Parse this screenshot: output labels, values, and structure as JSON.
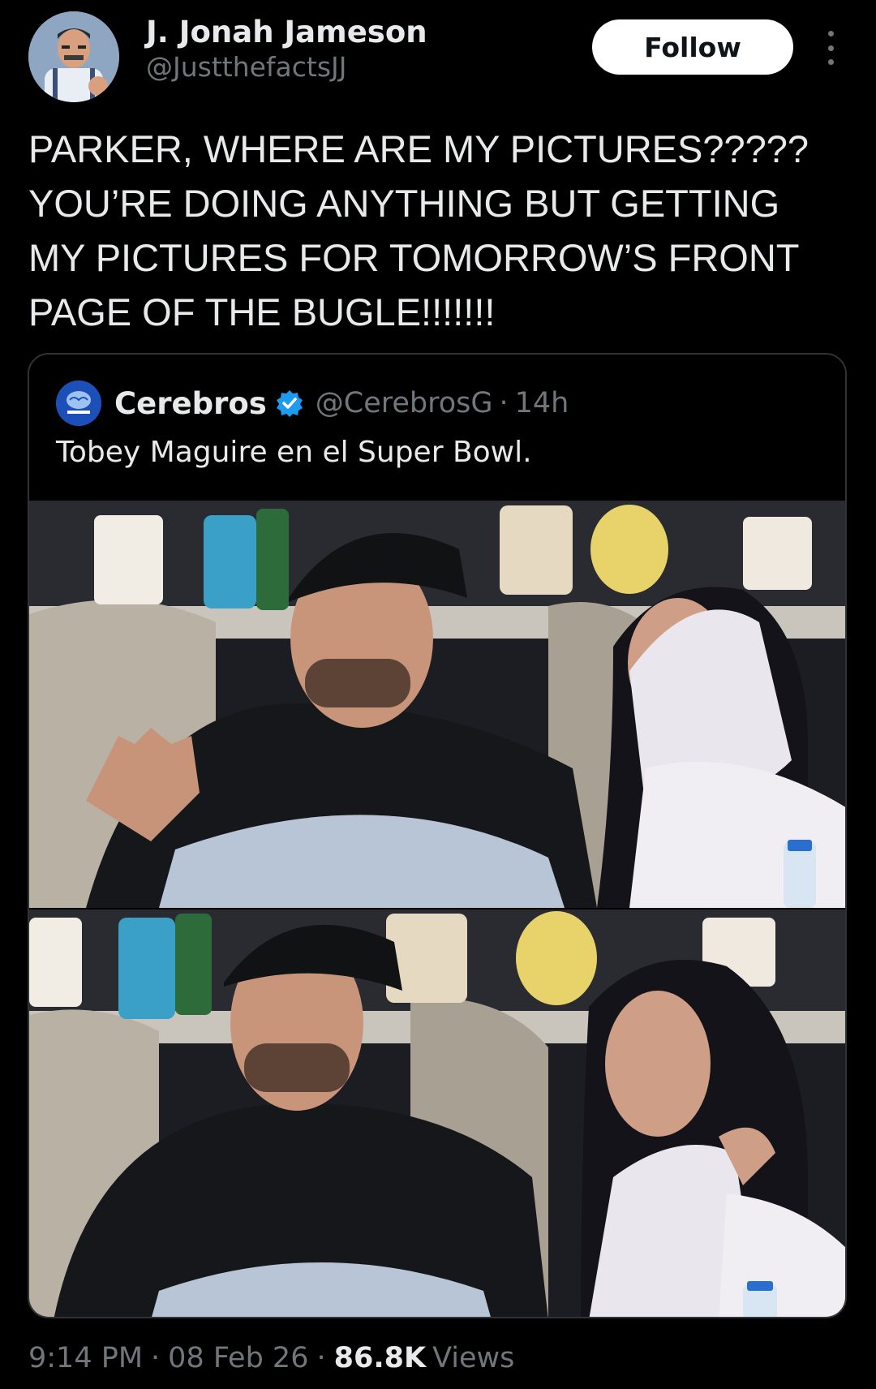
{
  "author": {
    "display_name": "J. Jonah Jameson",
    "handle": "@JustthefactsJJ"
  },
  "follow_label": "Follow",
  "more_icon": "more-vertical-icon",
  "tweet_text": "PARKER, WHERE ARE MY PICTURES?????\nYOU’RE DOING ANYTHING BUT GETTING\nMY PICTURES FOR TOMORROW’S FRONT\nPAGE OF THE BUGLE!!!!!!!",
  "quoted": {
    "name": "Cerebros",
    "verified_icon": "verified-badge-icon",
    "handle": "@CerebrosG",
    "separator": "·",
    "time": "14h",
    "text": "Tobey Maguire en el Super Bowl."
  },
  "meta": {
    "time": "9:14 PM",
    "separator": "·",
    "date": "08 Feb 26",
    "views_count": "86.8K",
    "views_label": "Views"
  },
  "colors": {
    "background": "#000000",
    "primary_text": "#e7e9ea",
    "secondary_text": "#71767b",
    "border": "#2f3336",
    "follow_bg": "#ffffff",
    "verified": "#1d9bf0"
  }
}
